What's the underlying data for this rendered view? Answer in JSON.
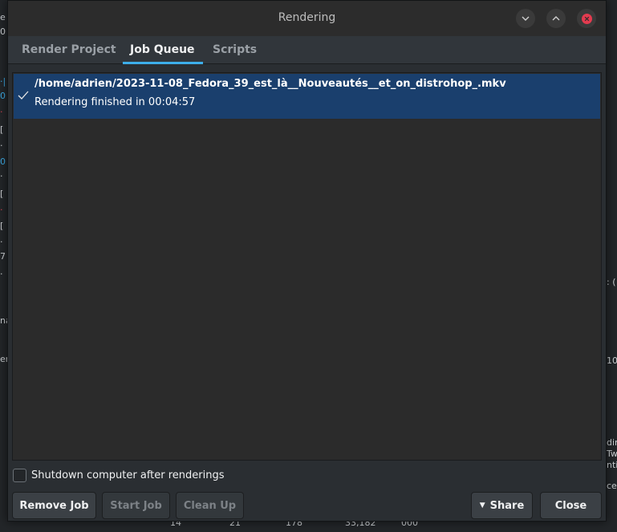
{
  "background": {
    "left_fragments": [
      "e",
      "0",
      "·|",
      "0",
      "·",
      "[",
      "·",
      "0",
      "·",
      "[",
      "·",
      "[",
      "·",
      "7",
      "·",
      "na",
      "er"
    ],
    "right_fragments": [
      ": (",
      "10",
      "din",
      "Tw",
      "nti",
      "cet"
    ],
    "bottom_fragments": [
      "14",
      "21",
      "178",
      "33,182",
      "000"
    ]
  },
  "window": {
    "title": "Rendering"
  },
  "tabs": [
    {
      "label": "Render Project"
    },
    {
      "label": "Job Queue"
    },
    {
      "label": "Scripts"
    }
  ],
  "active_tab": "Job Queue",
  "jobs": [
    {
      "path": "/home/adrien/2023-11-08_Fedora_39_est_là__Nouveautés__et_on_distrohop_.mkv",
      "status": "Rendering finished in 00:04:57"
    }
  ],
  "shutdown": {
    "label": "Shutdown computer after renderings",
    "checked": false
  },
  "buttons": {
    "remove_job": "Remove Job",
    "start_job": "Start Job",
    "clean_up": "Clean Up",
    "share": "Share",
    "close": "Close"
  },
  "colors": {
    "accent": "#3daee9",
    "selection": "#1a3f6d",
    "close_red": "#e33b4f"
  }
}
